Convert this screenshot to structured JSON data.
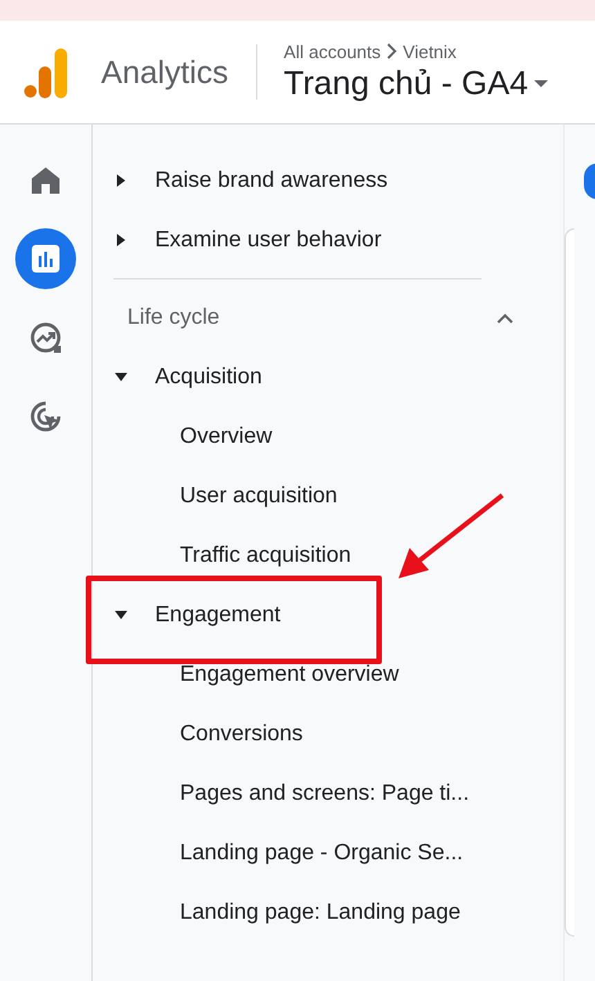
{
  "header": {
    "product": "Analytics",
    "breadcrumb": {
      "parent": "All accounts",
      "current": "Vietnix"
    },
    "property": "Trang chủ - GA4"
  },
  "rail": [
    {
      "kind": "home",
      "selected": false
    },
    {
      "kind": "reports",
      "selected": true
    },
    {
      "kind": "explore",
      "selected": false
    },
    {
      "kind": "advertising",
      "selected": false
    }
  ],
  "nav": {
    "topics": [
      {
        "label": "Raise brand awareness",
        "expanded": false
      },
      {
        "label": "Examine user behavior",
        "expanded": false
      }
    ],
    "section": {
      "title": "Life cycle",
      "expanded": true,
      "items": [
        {
          "label": "Acquisition",
          "expanded": true,
          "children": [
            {
              "label": "Overview"
            },
            {
              "label": "User acquisition"
            },
            {
              "label": "Traffic acquisition"
            }
          ]
        },
        {
          "label": "Engagement",
          "expanded": true,
          "children": [
            {
              "label": "Engagement overview"
            },
            {
              "label": "Conversions"
            },
            {
              "label": "Pages and screens: Page ti..."
            },
            {
              "label": "Landing page - Organic Se..."
            },
            {
              "label": "Landing page: Landing page"
            }
          ]
        }
      ]
    }
  }
}
